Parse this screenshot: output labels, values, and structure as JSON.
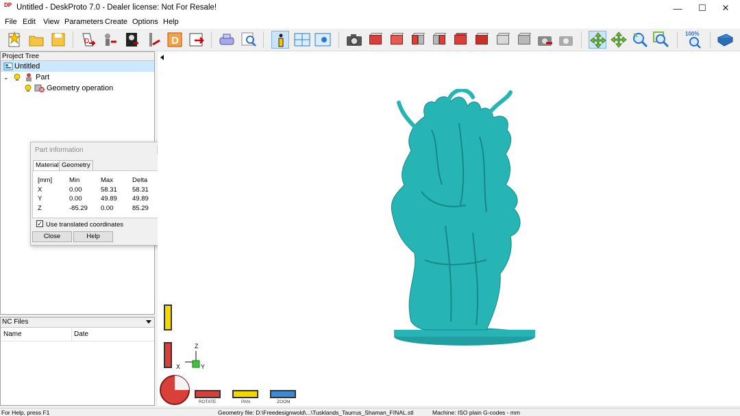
{
  "window": {
    "title": "Untitled - DeskProto 7.0 - Dealer license: Not For Resale!",
    "app_icon": "DP"
  },
  "menu": [
    "File",
    "Edit",
    "View",
    "Parameters",
    "Create",
    "Options",
    "Help"
  ],
  "toolbar": {
    "icons": [
      "new-project-icon",
      "open-project-icon",
      "save-project-icon",
      "import-geometry-icon",
      "part-move-icon",
      "image-icon",
      "bitmap-icon",
      "drawing-icon",
      "export-icon",
      "machine-icon",
      "preview-icon",
      "info-icon",
      "layout-icon",
      "view-settings-icon",
      "camera-icon",
      "front-view-icon",
      "back-view-icon",
      "left-view-icon",
      "right-view-icon",
      "top-view-icon",
      "bottom-view-icon",
      "iso-view-icon",
      "grey-view-icon",
      "render-icon",
      "render-settings-icon",
      "rotate-tool-icon",
      "pan-tool-icon",
      "zoom-tool-icon",
      "zoom-window-icon",
      "zoom-all-icon",
      "help-book-icon"
    ],
    "zoom_label": "100%"
  },
  "project_tree": {
    "header": "Project Tree",
    "items": [
      {
        "label": "Untitled",
        "level": 0,
        "icon": "project-icon"
      },
      {
        "label": "Part",
        "level": 1,
        "icon": "part-icon"
      },
      {
        "label": "Geometry operation",
        "level": 2,
        "icon": "geometry-operation-icon"
      }
    ]
  },
  "part_info": {
    "title": "Part information",
    "tabs": [
      "Material",
      "Geometry"
    ],
    "selected_tab": "Material",
    "columns": [
      "[mm]",
      "Min",
      "Max",
      "Delta"
    ],
    "rows": [
      [
        "X",
        "0.00",
        "58.31",
        "58.31"
      ],
      [
        "Y",
        "0.00",
        "49.89",
        "49.89"
      ],
      [
        "Z",
        "-85.29",
        "0.00",
        "85.29"
      ]
    ],
    "checkbox_label": "Use translated coordinates",
    "checkbox_checked": true,
    "close_label": "Close",
    "help_label": "Help"
  },
  "nc_files": {
    "header": "NC Files",
    "columns": [
      "Name",
      "Date"
    ]
  },
  "viewport": {
    "axes": {
      "z": "Z",
      "x": "X",
      "y": "Y"
    },
    "tools": [
      "ROTATE",
      "PAN",
      "ZOOM"
    ]
  },
  "status": {
    "help": "For Help, press F1",
    "geometry": "Geometry file: D:\\Freedesignwold\\...\\Tusklands_Taurrus_Shaman_FINAL.stl",
    "machine": "Machine: ISO plain G-codes - mm"
  },
  "colors": {
    "model": "#27b4b4",
    "accent": "#0078d7",
    "selection": "#cce8ff"
  }
}
